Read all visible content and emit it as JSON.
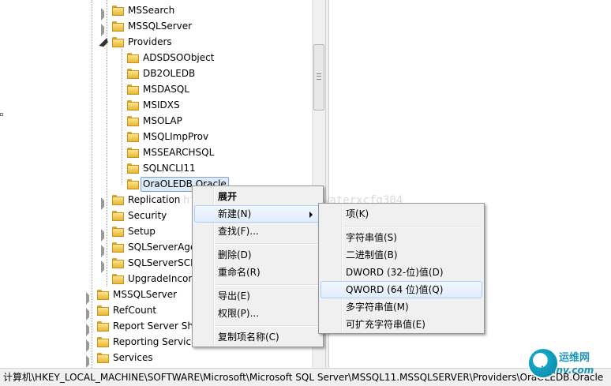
{
  "tree": {
    "nodes": [
      {
        "label": "MSSearch",
        "expander": "closed"
      },
      {
        "label": "MSSQLServer",
        "expander": "closed"
      },
      {
        "label": "Providers",
        "expander": "open"
      },
      {
        "label": "ADSDSOObject",
        "expander": "none"
      },
      {
        "label": "DB2OLEDB",
        "expander": "none"
      },
      {
        "label": "MSDASQL",
        "expander": "none"
      },
      {
        "label": "MSIDXS",
        "expander": "none"
      },
      {
        "label": "MSOLAP",
        "expander": "none"
      },
      {
        "label": "MSQLImpProv",
        "expander": "none"
      },
      {
        "label": "MSSEARCHSQL",
        "expander": "none"
      },
      {
        "label": "SQLNCLI11",
        "expander": "none"
      },
      {
        "label": "OraOLEDB.Oracle",
        "expander": "none",
        "selected": true
      },
      {
        "label": "Replication",
        "expander": "closed"
      },
      {
        "label": "Security",
        "expander": "none"
      },
      {
        "label": "Setup",
        "expander": "closed"
      },
      {
        "label": "SQLServerAgent",
        "expander": "closed"
      },
      {
        "label": "SQLServerSCP",
        "expander": "closed"
      },
      {
        "label": "UpgradeIncompleteState",
        "expander": "none"
      },
      {
        "label": "MSSQLServer",
        "expander": "closed"
      },
      {
        "label": "RefCount",
        "expander": "closed"
      },
      {
        "label": "Report Server Shared",
        "expander": "closed"
      },
      {
        "label": "Reporting Services",
        "expander": "closed"
      },
      {
        "label": "Services",
        "expander": "closed"
      }
    ]
  },
  "context_menu": {
    "items": [
      "展开",
      "新建(N)",
      "查找(F)...",
      "删除(D)",
      "重命名(R)",
      "导出(E)",
      "权限(P)...",
      "复制项名称(C)"
    ]
  },
  "submenu": {
    "items": [
      "项(K)",
      "字符串值(S)",
      "二进制值(B)",
      "DWORD (32-位)值(D)",
      "QWORD (64 位)值(Q)",
      "多字符串值(M)",
      "可扩充字符串值(E)"
    ]
  },
  "status_bar": {
    "path": "计算机\\HKEY_LOCAL_MACHINE\\SOFTWARE\\Microsoft\\Microsoft SQL Server\\MSSQL11.MSSQLSERVER\\Providers\\OraOLEDB.Oracle"
  },
  "watermark": "http://blog.csdn.net/waterxcfg304",
  "logo": {
    "name": "运维网",
    "url": "iyunv.com"
  }
}
